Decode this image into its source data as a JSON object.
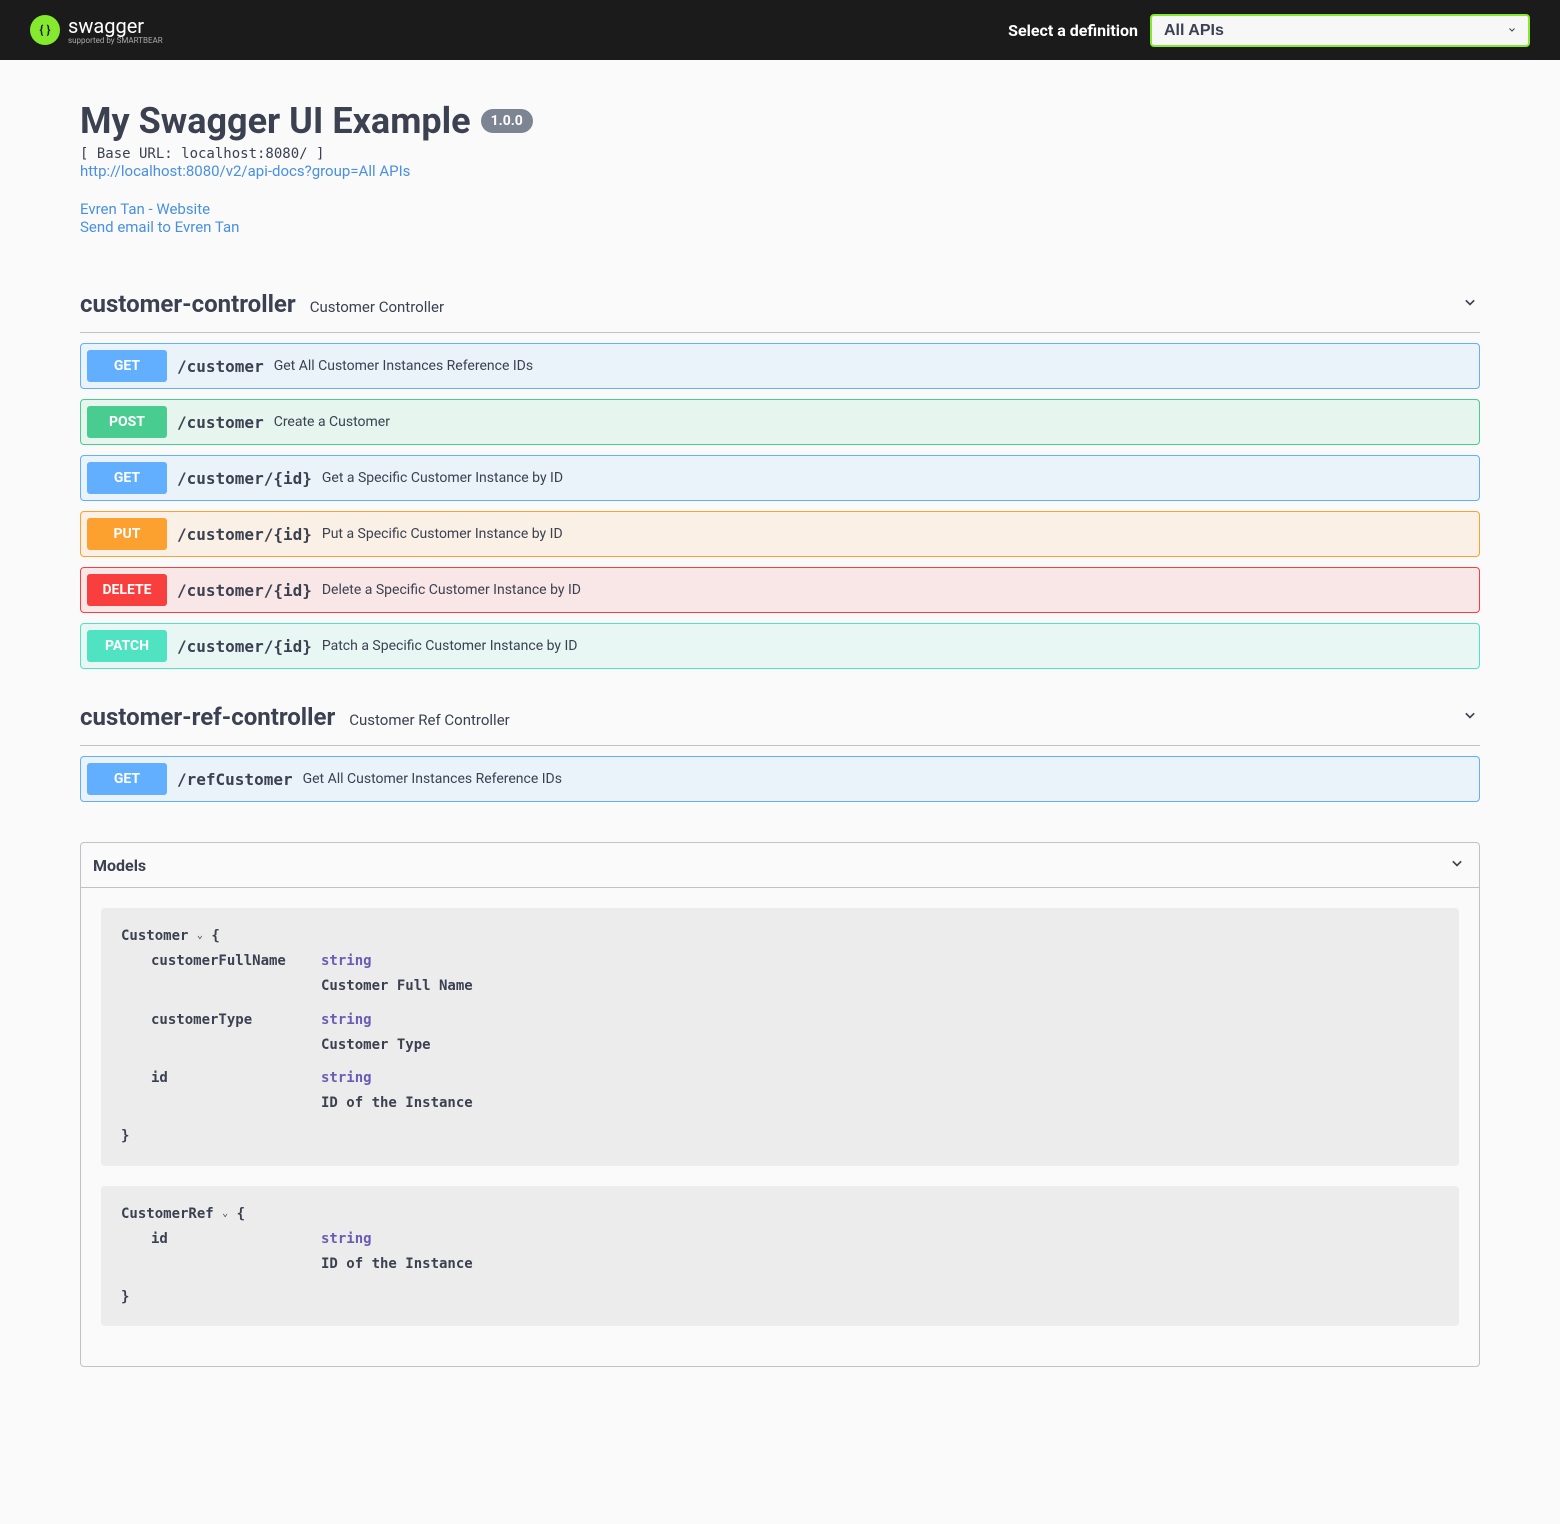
{
  "topbar": {
    "logo_main": "swagger",
    "logo_sub": "supported by SMARTBEAR",
    "def_label": "Select a definition",
    "def_selected": "All APIs"
  },
  "info": {
    "title": "My Swagger UI Example",
    "version": "1.0.0",
    "base_url": "[ Base URL: localhost:8080/ ]",
    "docs_url": "http://localhost:8080/v2/api-docs?group=All APIs",
    "contact_website": "Evren Tan - Website",
    "contact_email": "Send email to Evren Tan"
  },
  "tags": [
    {
      "name": "customer-controller",
      "desc": "Customer Controller",
      "ops": [
        {
          "method": "GET",
          "path": "/customer",
          "summary": "Get All Customer Instances Reference IDs"
        },
        {
          "method": "POST",
          "path": "/customer",
          "summary": "Create a Customer"
        },
        {
          "method": "GET",
          "path": "/customer/{id}",
          "summary": "Get a Specific Customer Instance by ID"
        },
        {
          "method": "PUT",
          "path": "/customer/{id}",
          "summary": "Put a Specific Customer Instance by ID"
        },
        {
          "method": "DELETE",
          "path": "/customer/{id}",
          "summary": "Delete a Specific Customer Instance by ID"
        },
        {
          "method": "PATCH",
          "path": "/customer/{id}",
          "summary": "Patch a Specific Customer Instance by ID"
        }
      ]
    },
    {
      "name": "customer-ref-controller",
      "desc": "Customer Ref Controller",
      "ops": [
        {
          "method": "GET",
          "path": "/refCustomer",
          "summary": "Get All Customer Instances Reference IDs"
        }
      ]
    }
  ],
  "models_title": "Models",
  "models": [
    {
      "name": "Customer",
      "props": [
        {
          "name": "customerFullName",
          "type": "string",
          "desc": "Customer Full Name"
        },
        {
          "name": "customerType",
          "type": "string",
          "desc": "Customer Type"
        },
        {
          "name": "id",
          "type": "string",
          "desc": "ID of the Instance"
        }
      ]
    },
    {
      "name": "CustomerRef",
      "props": [
        {
          "name": "id",
          "type": "string",
          "desc": "ID of the Instance"
        }
      ]
    }
  ]
}
